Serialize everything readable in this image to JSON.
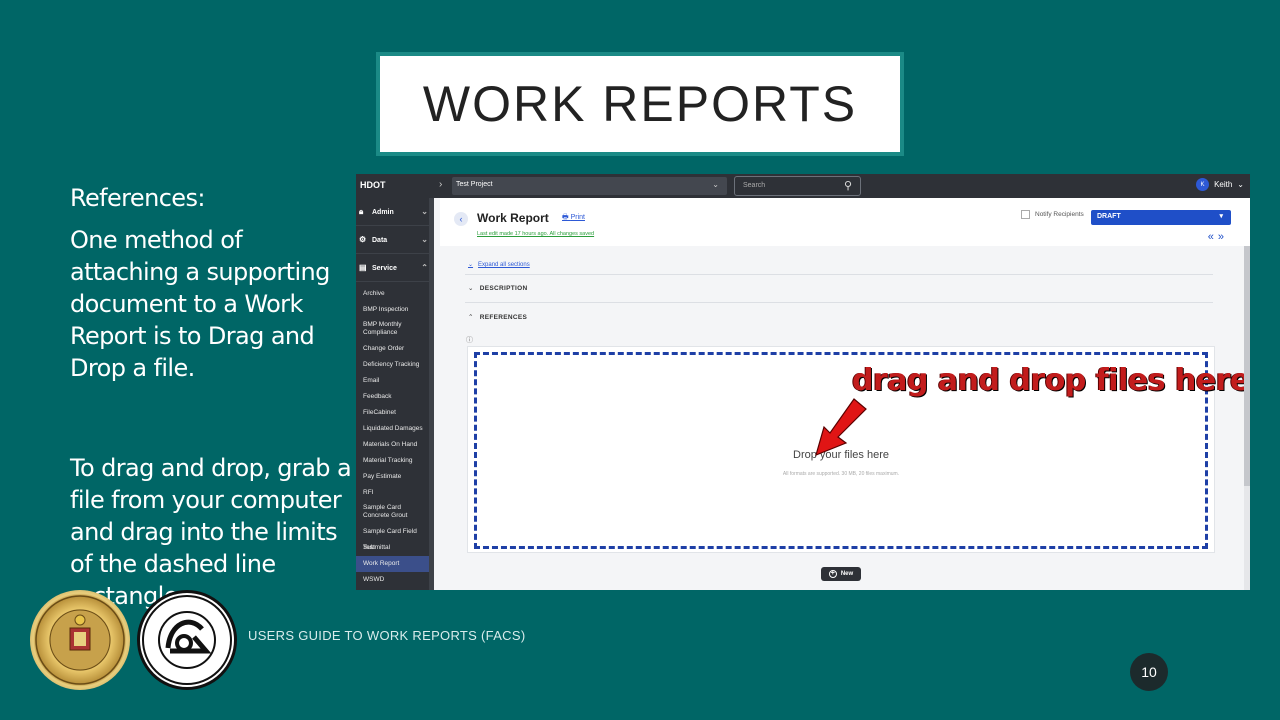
{
  "slide": {
    "title": "WORK REPORTS",
    "paragraphs": [
      "References:",
      "One method of attaching a supporting document to a Work Report is to Drag and Drop a file.",
      "To drag and drop, grab a file from your computer and drag into the limits of the dashed line rectangle"
    ],
    "footer": "USERS GUIDE TO WORK REPORTS  (FACS)",
    "page_number": "10",
    "seal_left_text": "STATE OF HAWAII",
    "seal_right_text": "DEPARTMENT OF TRANSPORTATION · STATE OF HAWAII"
  },
  "app": {
    "brand": "HDOT",
    "project": "Test Project",
    "search_placeholder": "Search",
    "user": {
      "initial": "K",
      "name": "Keith"
    },
    "sidebar": {
      "groups": [
        {
          "label": "Admin",
          "icon": "lock-icon"
        },
        {
          "label": "Data",
          "icon": "gears-icon"
        },
        {
          "label": "Service",
          "icon": "document-icon"
        }
      ],
      "items": [
        "Archive",
        "BMP Inspection",
        "BMP Monthly Compliance",
        "Change Order",
        "Deficiency Tracking",
        "Email",
        "Feedback",
        "FileCabinet",
        "Liquidated Damages",
        "Materials On Hand",
        "Material Tracking",
        "Pay Estimate",
        "RFI",
        "Sample Card Concrete Grout",
        "Sample Card Field Test",
        "Submittal",
        "Work Report",
        "WSWD"
      ],
      "active_item": "Work Report"
    },
    "header": {
      "title": "Work Report",
      "print_label": "Print",
      "last_edit": "Last edit made 17 hours ago. All changes saved",
      "notify_label": "Notify Recipients",
      "status": "DRAFT"
    },
    "expand_all": "Expand all sections",
    "sections": [
      "DESCRIPTION",
      "REFERENCES"
    ],
    "dropzone": {
      "main": "Drop your files here",
      "sub": "All formats are supported. 30 MB, 20 files maximum."
    },
    "annotation": "drag and drop files here",
    "new_button": "New"
  }
}
